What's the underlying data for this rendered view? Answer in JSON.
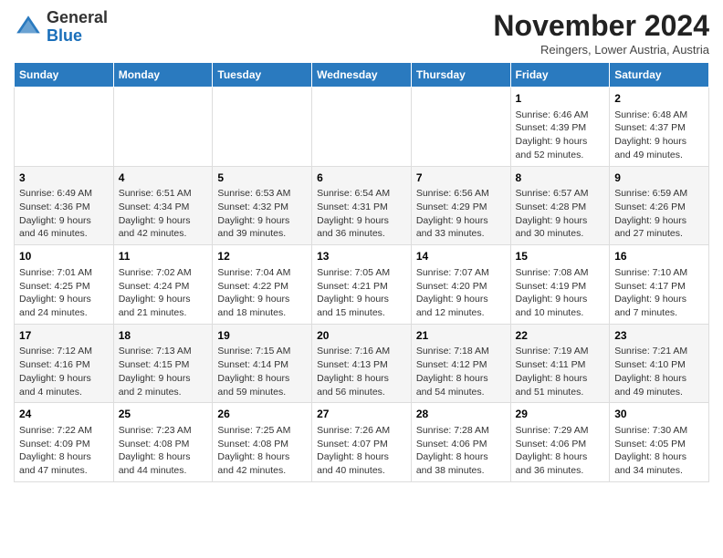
{
  "header": {
    "logo_general": "General",
    "logo_blue": "Blue",
    "month_title": "November 2024",
    "location": "Reingers, Lower Austria, Austria"
  },
  "days_of_week": [
    "Sunday",
    "Monday",
    "Tuesday",
    "Wednesday",
    "Thursday",
    "Friday",
    "Saturday"
  ],
  "weeks": [
    {
      "days": [
        {
          "number": "",
          "info": ""
        },
        {
          "number": "",
          "info": ""
        },
        {
          "number": "",
          "info": ""
        },
        {
          "number": "",
          "info": ""
        },
        {
          "number": "",
          "info": ""
        },
        {
          "number": "1",
          "info": "Sunrise: 6:46 AM\nSunset: 4:39 PM\nDaylight: 9 hours and 52 minutes."
        },
        {
          "number": "2",
          "info": "Sunrise: 6:48 AM\nSunset: 4:37 PM\nDaylight: 9 hours and 49 minutes."
        }
      ]
    },
    {
      "days": [
        {
          "number": "3",
          "info": "Sunrise: 6:49 AM\nSunset: 4:36 PM\nDaylight: 9 hours and 46 minutes."
        },
        {
          "number": "4",
          "info": "Sunrise: 6:51 AM\nSunset: 4:34 PM\nDaylight: 9 hours and 42 minutes."
        },
        {
          "number": "5",
          "info": "Sunrise: 6:53 AM\nSunset: 4:32 PM\nDaylight: 9 hours and 39 minutes."
        },
        {
          "number": "6",
          "info": "Sunrise: 6:54 AM\nSunset: 4:31 PM\nDaylight: 9 hours and 36 minutes."
        },
        {
          "number": "7",
          "info": "Sunrise: 6:56 AM\nSunset: 4:29 PM\nDaylight: 9 hours and 33 minutes."
        },
        {
          "number": "8",
          "info": "Sunrise: 6:57 AM\nSunset: 4:28 PM\nDaylight: 9 hours and 30 minutes."
        },
        {
          "number": "9",
          "info": "Sunrise: 6:59 AM\nSunset: 4:26 PM\nDaylight: 9 hours and 27 minutes."
        }
      ]
    },
    {
      "days": [
        {
          "number": "10",
          "info": "Sunrise: 7:01 AM\nSunset: 4:25 PM\nDaylight: 9 hours and 24 minutes."
        },
        {
          "number": "11",
          "info": "Sunrise: 7:02 AM\nSunset: 4:24 PM\nDaylight: 9 hours and 21 minutes."
        },
        {
          "number": "12",
          "info": "Sunrise: 7:04 AM\nSunset: 4:22 PM\nDaylight: 9 hours and 18 minutes."
        },
        {
          "number": "13",
          "info": "Sunrise: 7:05 AM\nSunset: 4:21 PM\nDaylight: 9 hours and 15 minutes."
        },
        {
          "number": "14",
          "info": "Sunrise: 7:07 AM\nSunset: 4:20 PM\nDaylight: 9 hours and 12 minutes."
        },
        {
          "number": "15",
          "info": "Sunrise: 7:08 AM\nSunset: 4:19 PM\nDaylight: 9 hours and 10 minutes."
        },
        {
          "number": "16",
          "info": "Sunrise: 7:10 AM\nSunset: 4:17 PM\nDaylight: 9 hours and 7 minutes."
        }
      ]
    },
    {
      "days": [
        {
          "number": "17",
          "info": "Sunrise: 7:12 AM\nSunset: 4:16 PM\nDaylight: 9 hours and 4 minutes."
        },
        {
          "number": "18",
          "info": "Sunrise: 7:13 AM\nSunset: 4:15 PM\nDaylight: 9 hours and 2 minutes."
        },
        {
          "number": "19",
          "info": "Sunrise: 7:15 AM\nSunset: 4:14 PM\nDaylight: 8 hours and 59 minutes."
        },
        {
          "number": "20",
          "info": "Sunrise: 7:16 AM\nSunset: 4:13 PM\nDaylight: 8 hours and 56 minutes."
        },
        {
          "number": "21",
          "info": "Sunrise: 7:18 AM\nSunset: 4:12 PM\nDaylight: 8 hours and 54 minutes."
        },
        {
          "number": "22",
          "info": "Sunrise: 7:19 AM\nSunset: 4:11 PM\nDaylight: 8 hours and 51 minutes."
        },
        {
          "number": "23",
          "info": "Sunrise: 7:21 AM\nSunset: 4:10 PM\nDaylight: 8 hours and 49 minutes."
        }
      ]
    },
    {
      "days": [
        {
          "number": "24",
          "info": "Sunrise: 7:22 AM\nSunset: 4:09 PM\nDaylight: 8 hours and 47 minutes."
        },
        {
          "number": "25",
          "info": "Sunrise: 7:23 AM\nSunset: 4:08 PM\nDaylight: 8 hours and 44 minutes."
        },
        {
          "number": "26",
          "info": "Sunrise: 7:25 AM\nSunset: 4:08 PM\nDaylight: 8 hours and 42 minutes."
        },
        {
          "number": "27",
          "info": "Sunrise: 7:26 AM\nSunset: 4:07 PM\nDaylight: 8 hours and 40 minutes."
        },
        {
          "number": "28",
          "info": "Sunrise: 7:28 AM\nSunset: 4:06 PM\nDaylight: 8 hours and 38 minutes."
        },
        {
          "number": "29",
          "info": "Sunrise: 7:29 AM\nSunset: 4:06 PM\nDaylight: 8 hours and 36 minutes."
        },
        {
          "number": "30",
          "info": "Sunrise: 7:30 AM\nSunset: 4:05 PM\nDaylight: 8 hours and 34 minutes."
        }
      ]
    }
  ]
}
